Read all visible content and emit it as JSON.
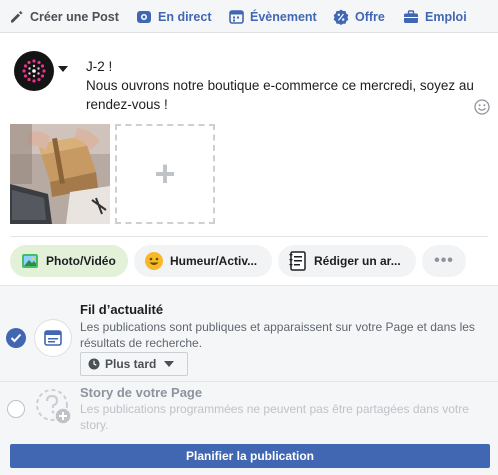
{
  "tabs": {
    "create_post": "Créer une Post",
    "live": "En direct",
    "event": "Évènement",
    "offer": "Offre",
    "job": "Emploi"
  },
  "composer": {
    "line1": "J-2 !",
    "line2": "Nous ouvrons notre boutique e-commerce ce mercredi, soyez au rendez-vous !",
    "add_photo_symbol": "+"
  },
  "actions": {
    "photo_video": "Photo/Vidéo",
    "mood": "Humeur/Activ...",
    "article": "Rédiger un ar...",
    "more": "•••"
  },
  "audience": {
    "feed_title": "Fil d’actualité",
    "feed_desc": "Les publications sont publiques et apparaissent sur votre Page et dans les résultats de recherche.",
    "later": "Plus tard",
    "story_title": "Story de votre Page",
    "story_desc": "Les publications programmées ne peuvent pas être partagées dans votre story."
  },
  "footer": {
    "schedule": "Planifier la publication"
  },
  "colors": {
    "accent": "#4267b2",
    "topbar_bg": "#f5f6f7",
    "photo_pill_bg": "#e3f1d9"
  },
  "icons": {
    "create": "pencil-icon",
    "live": "live-video-icon",
    "event": "calendar-icon",
    "offer": "percent-tag-icon",
    "job": "briefcase-icon",
    "emoji": "smiley-icon",
    "photo": "image-icon",
    "mood": "smiley-face-icon",
    "article": "document-icon",
    "feed": "news-feed-icon",
    "story": "story-add-icon",
    "check": "check-icon",
    "clock": "clock-icon"
  }
}
